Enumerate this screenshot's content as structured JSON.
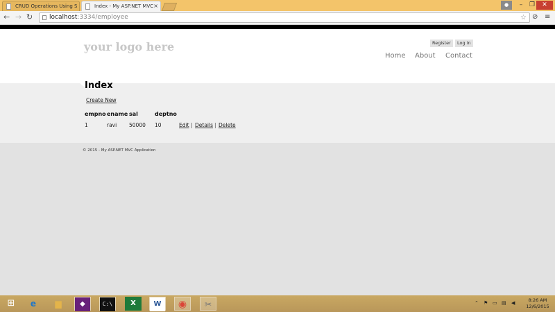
{
  "browser": {
    "tabs": [
      {
        "title": "CRUD Operations Using S",
        "active": false
      },
      {
        "title": "Index - My ASP.NET MVC",
        "active": true
      }
    ],
    "address": {
      "host": "localhost",
      "path": ":3334/employee"
    }
  },
  "site": {
    "logo": "your logo here",
    "login": {
      "register": "Register",
      "login": "Log in"
    },
    "menu": {
      "home": "Home",
      "about": "About",
      "contact": "Contact"
    },
    "footer": "© 2015 - My ASP.NET MVC Application"
  },
  "page": {
    "title": "Index",
    "create_link": "Create New",
    "table": {
      "headers": {
        "empno": "empno",
        "ename": "ename",
        "sal": "sal",
        "deptno": "deptno"
      },
      "rows": [
        {
          "empno": "1",
          "ename": "ravi",
          "sal": "50000",
          "deptno": "10",
          "actions": {
            "edit": "Edit",
            "details": "Details",
            "delete": "Delete"
          }
        }
      ],
      "separator": "|"
    }
  },
  "taskbar": {
    "apps": [
      "start",
      "internet-explorer",
      "file-explorer",
      "visual-studio",
      "command-prompt",
      "excel",
      "word",
      "chrome",
      "tools"
    ],
    "clock": {
      "time": "8:26 AM",
      "date": "12/6/2015"
    }
  },
  "colors": {
    "titlebar": "#f3c46a",
    "taskbar": "#c9a862",
    "close": "#c84031"
  }
}
